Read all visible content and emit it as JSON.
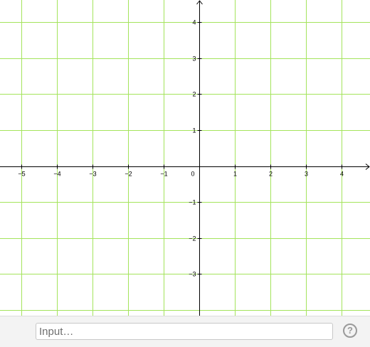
{
  "chart_data": {
    "type": "scatter",
    "title": "",
    "xlabel": "",
    "ylabel": "",
    "xlim": [
      -5.6,
      4.8
    ],
    "ylim": [
      -4.16,
      4.62
    ],
    "x_ticks": [
      -5,
      -4,
      -3,
      -2,
      -1,
      1,
      2,
      3,
      4
    ],
    "y_ticks": [
      4,
      3,
      2,
      1,
      -1,
      -2,
      -3
    ],
    "x_tick_labels": [
      "−5",
      "−4",
      "−3",
      "−2",
      "−1",
      "1",
      "2",
      "3",
      "4"
    ],
    "y_tick_labels": [
      "4",
      "3",
      "2",
      "1",
      "−1",
      "−2",
      "−3"
    ],
    "origin_label": "0",
    "grid": true,
    "series": []
  },
  "colors": {
    "grid": "#a4e45c",
    "axis": "#000000",
    "tick_text": "#000000",
    "input_bar_bg": "#f3f3f3"
  },
  "input_bar": {
    "placeholder": "Input…",
    "value": "",
    "help_label": "?",
    "help_icon": "help-icon"
  }
}
